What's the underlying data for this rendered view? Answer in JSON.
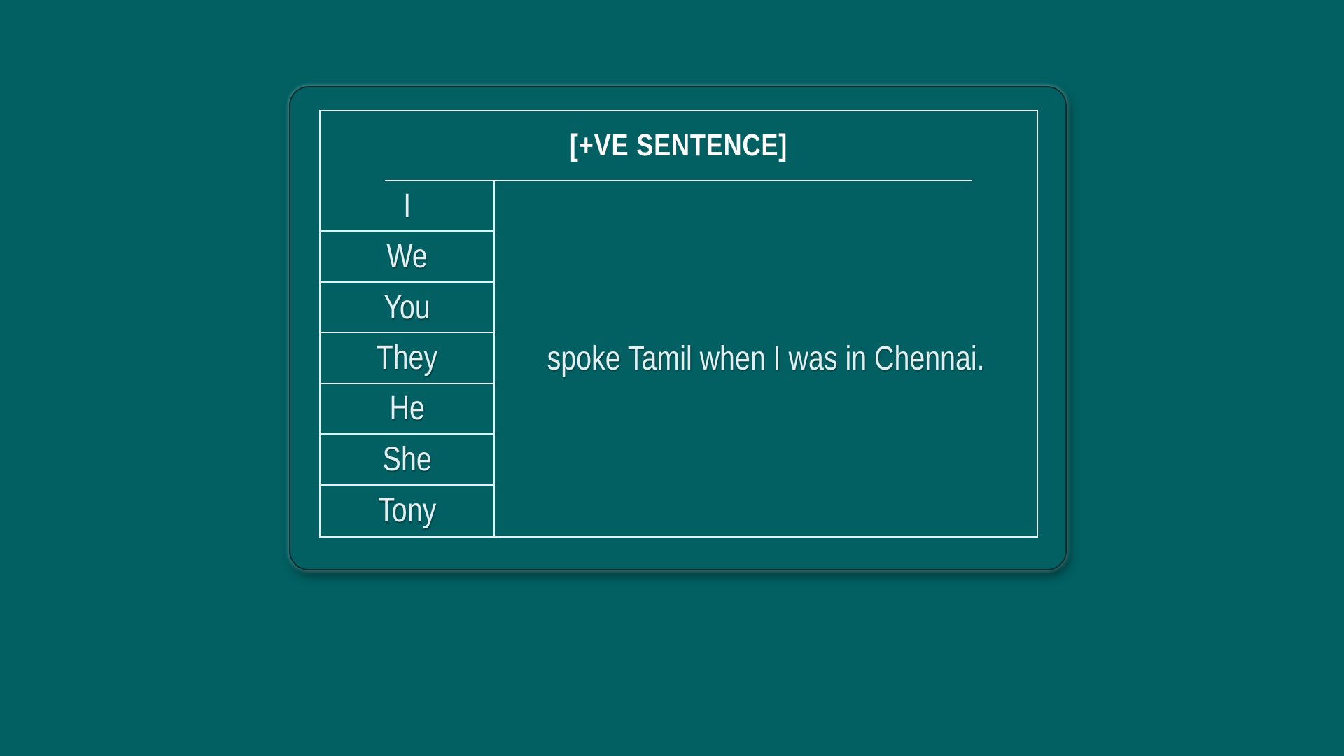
{
  "table": {
    "header": "[+VE SENTENCE]",
    "subjects": [
      "I",
      "We",
      "You",
      "They",
      "He",
      "She",
      "Tony"
    ],
    "predicate": "spoke Tamil when I was in Chennai."
  }
}
